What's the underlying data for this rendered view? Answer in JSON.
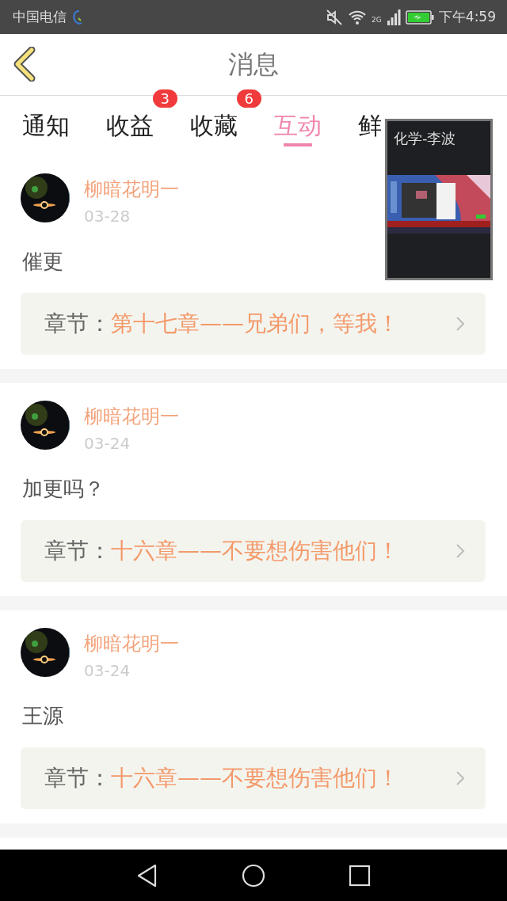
{
  "status_bar": {
    "carrier": "中国电信",
    "network": "2G",
    "time": "下午4:59"
  },
  "header": {
    "title": "消息"
  },
  "tabs": [
    {
      "label": "通知",
      "selected": false
    },
    {
      "label": "收益",
      "selected": false,
      "badge": "3"
    },
    {
      "label": "收藏",
      "selected": false,
      "badge": "6"
    },
    {
      "label": "互动",
      "selected": true
    },
    {
      "label": "鲜",
      "selected": false
    }
  ],
  "messages": [
    {
      "user": "柳暗花明一",
      "date": "03-28",
      "text": "催更",
      "chapter_label": "章节：",
      "chapter": "第十七章——兄弟们，等我！"
    },
    {
      "user": "柳暗花明一",
      "date": "03-24",
      "text": "加更吗？",
      "chapter_label": "章节：",
      "chapter": "十六章——不要想伤害他们！"
    },
    {
      "user": "柳暗花明一",
      "date": "03-24",
      "text": "王源",
      "chapter_label": "章节：",
      "chapter": "十六章——不要想伤害他们！"
    }
  ],
  "floating_window": {
    "title": "化学-李波",
    "kind": "picture"
  }
}
